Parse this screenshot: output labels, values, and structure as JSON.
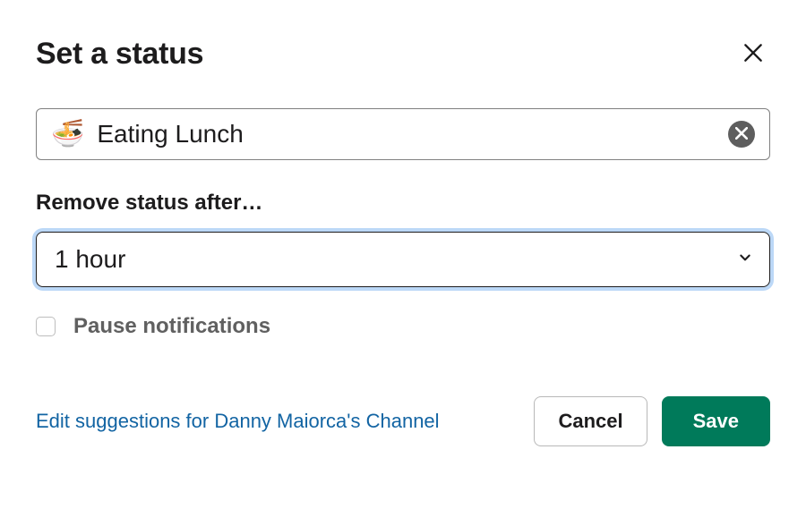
{
  "modal": {
    "title": "Set a status"
  },
  "status": {
    "emoji": "🍜",
    "value": "Eating Lunch"
  },
  "duration": {
    "label": "Remove status after…",
    "selected": "1 hour"
  },
  "pause": {
    "label": "Pause notifications",
    "checked": false
  },
  "footer": {
    "suggestions_link": "Edit suggestions for Danny Maiorca's Channel",
    "cancel": "Cancel",
    "save": "Save"
  }
}
